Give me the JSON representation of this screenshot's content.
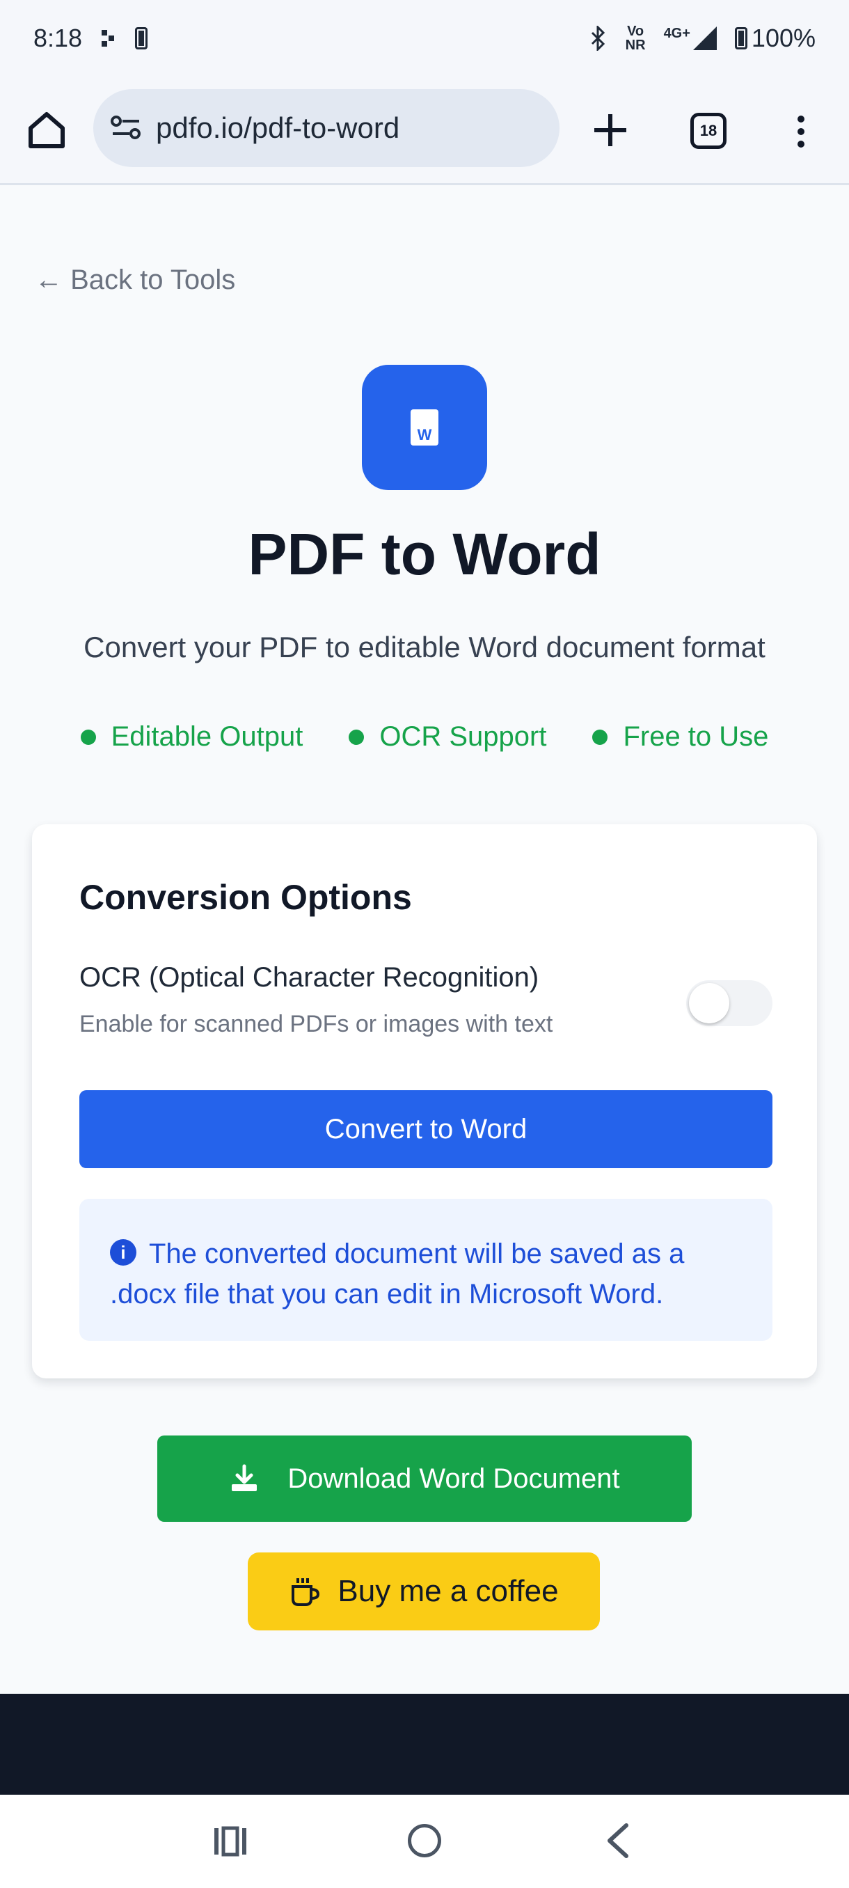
{
  "status_bar": {
    "time": "8:18",
    "vo_top": "Vo",
    "vo_bottom": "NR",
    "network": "4G+",
    "battery": "100%"
  },
  "browser": {
    "url": "pdfo.io/pdf-to-word",
    "tab_count": "18"
  },
  "page": {
    "back_link": "← Back to Tools",
    "icon_letter": "W",
    "title": "PDF to Word",
    "subtitle": "Convert your PDF to editable Word document format",
    "features": [
      "Editable Output",
      "OCR Support",
      "Free to Use"
    ]
  },
  "card": {
    "title": "Conversion Options",
    "ocr_label": "OCR (Optical Character Recognition)",
    "ocr_help": "Enable for scanned PDFs or images with text",
    "ocr_enabled": false,
    "convert_button": "Convert to Word",
    "info_icon": "i",
    "info_text": "The converted document will be saved as a .docx file that you can edit in Microsoft Word."
  },
  "actions": {
    "download_button": "Download Word Document",
    "coffee_button": "Buy me a coffee"
  },
  "colors": {
    "primary": "#2563eb",
    "success": "#16a34a",
    "coffee": "#facc15",
    "footer": "#111827"
  }
}
